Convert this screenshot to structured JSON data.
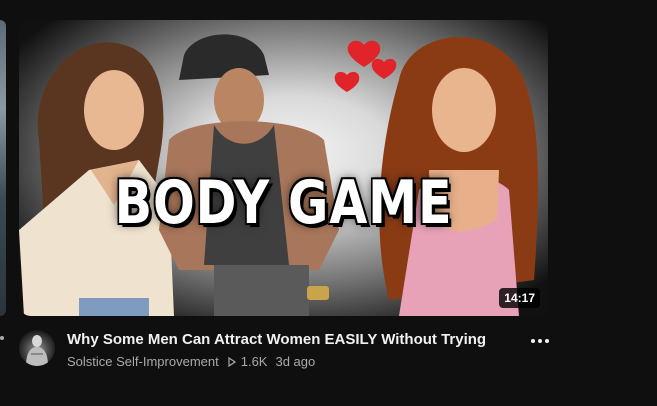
{
  "video": {
    "thumbnail_text": "BODY GAME",
    "duration": "14:17",
    "title": "Why Some Men Can Attract Women EASILY Without Trying",
    "channel": "Solstice Self-Improvement",
    "views": "1.6K",
    "age": "3d ago"
  },
  "icons": {
    "more": "more-vertical-icon",
    "views": "play-outline-icon",
    "hearts": "heart-icon"
  },
  "colors": {
    "background": "#0f0f0f",
    "text_primary": "#f1f1f1",
    "text_secondary": "#aaaaaa",
    "heart": "#e0242a"
  }
}
